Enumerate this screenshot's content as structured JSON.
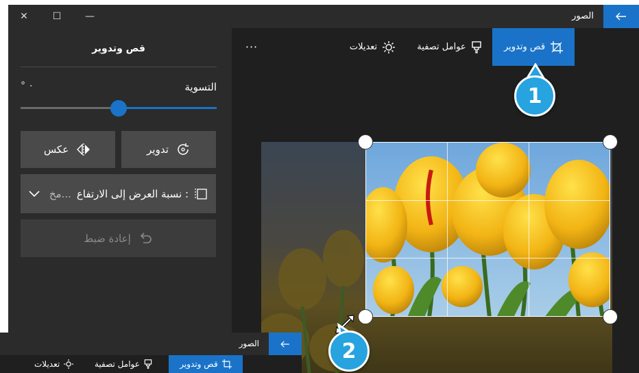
{
  "window": {
    "app_title": "الصور",
    "back_icon": "back-arrow-icon",
    "controls": {
      "close": "✕",
      "maximize": "☐",
      "minimize": "—"
    }
  },
  "toolbar": {
    "crop_label": "قص وتدوير",
    "filters_label": "عوامل تصفية",
    "adjust_label": "تعديلات",
    "more_label": "···"
  },
  "panel": {
    "title": "قص وتدوير",
    "straighten_label": "التسوية",
    "straighten_value": "° ٠",
    "rotate_label": "تدوير",
    "flip_label": "عكس",
    "aspect_label": "نسبة العرض إلى الارتفاع :",
    "aspect_value": "مخ...",
    "reset_label": "إعادة ضبط"
  },
  "callouts": {
    "one": "1",
    "two": "2"
  },
  "window2": {
    "app_title": "الصور",
    "crop_label": "قص وتدوير",
    "filters_label": "عوامل تصفية",
    "adjust_label": "تعديلات"
  },
  "colors": {
    "accent": "#1a73c8",
    "callout": "#27a3e0",
    "panel": "#2b2b2b",
    "canvas": "#1f1f1f"
  }
}
